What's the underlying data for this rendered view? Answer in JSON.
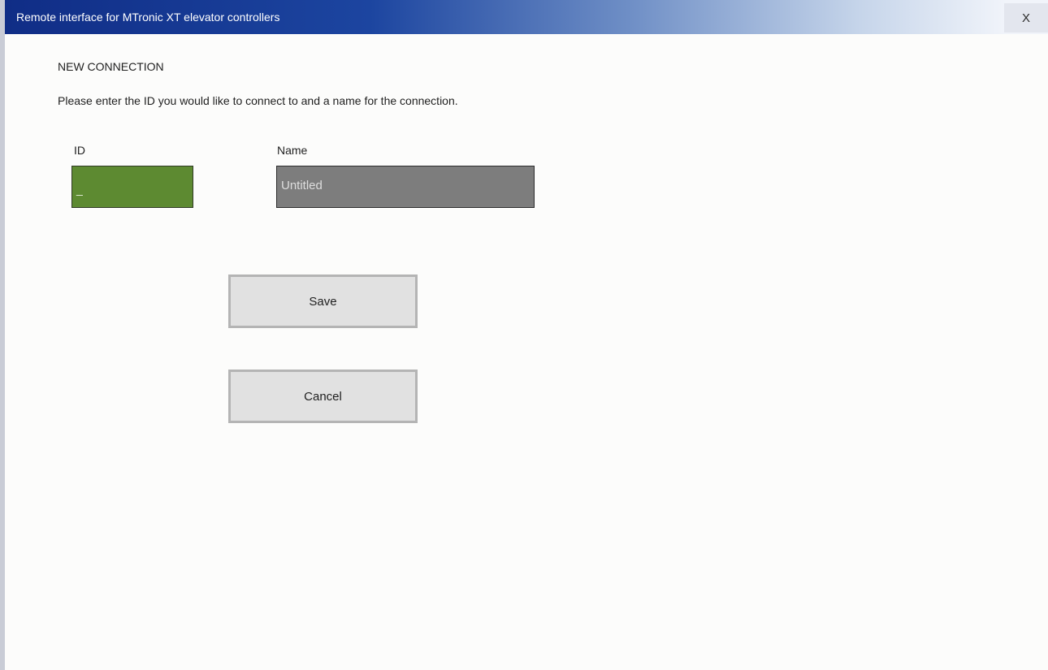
{
  "window": {
    "title": "Remote interface for MTronic XT elevator controllers",
    "close_label": "X"
  },
  "dialog": {
    "heading": "NEW CONNECTION",
    "instructions": "Please enter the ID you would like to connect to and a name for the connection.",
    "id_field": {
      "label": "ID",
      "value": "_"
    },
    "name_field": {
      "label": "Name",
      "value": "Untitled"
    },
    "save_label": "Save",
    "cancel_label": "Cancel"
  },
  "colors": {
    "titlebar_start": "#102d86",
    "id_field_bg": "#5d8a31",
    "name_field_bg": "#7d7d7d",
    "button_bg": "#e1e1e1"
  }
}
